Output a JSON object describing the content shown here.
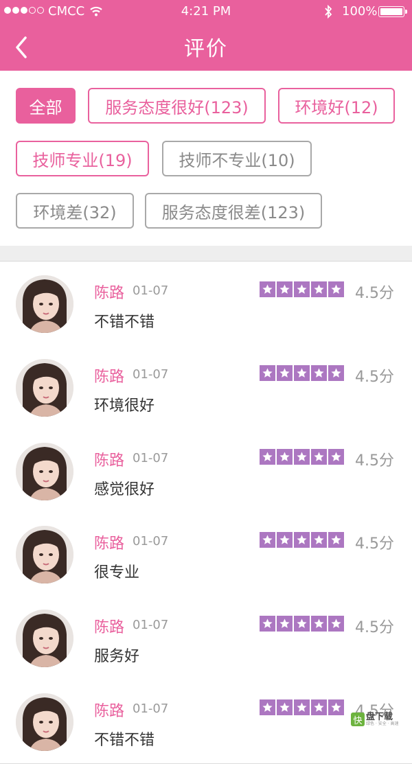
{
  "status_bar": {
    "carrier": "CMCC",
    "time": "4:21 PM",
    "battery": "100%"
  },
  "header": {
    "title": "评价"
  },
  "filters": [
    {
      "label": "全部"
    },
    {
      "label": "服务态度很好(123)"
    },
    {
      "label": "环境好(12)"
    },
    {
      "label": "技师专业(19)"
    },
    {
      "label": "技师不专业(10)"
    },
    {
      "label": "环境差(32)"
    },
    {
      "label": "服务态度很差(123)"
    }
  ],
  "reviews": [
    {
      "name": "陈路",
      "date": "01-07",
      "score": "4.5分",
      "rating": 4.5,
      "content": "不错不错"
    },
    {
      "name": "陈路",
      "date": "01-07",
      "score": "4.5分",
      "rating": 4.5,
      "content": "环境很好"
    },
    {
      "name": "陈路",
      "date": "01-07",
      "score": "4.5分",
      "rating": 4.5,
      "content": "感觉很好"
    },
    {
      "name": "陈路",
      "date": "01-07",
      "score": "4.5分",
      "rating": 4.5,
      "content": "很专业"
    },
    {
      "name": "陈路",
      "date": "01-07",
      "score": "4.5分",
      "rating": 4.5,
      "content": "服务好"
    },
    {
      "name": "陈路",
      "date": "01-07",
      "score": "4.5分",
      "rating": 4.5,
      "content": "不错不错"
    }
  ],
  "watermark": {
    "logo": "快",
    "name": "盘下载",
    "slogan": "绿色 · 安全 · 高速"
  },
  "colors": {
    "brand": "#e9609d",
    "star": "#ac77c1",
    "muted": "#999999"
  },
  "icons": [
    "signal-icon",
    "wifi-icon",
    "bluetooth-icon",
    "battery-icon",
    "back-arrow-icon",
    "star-icon"
  ]
}
